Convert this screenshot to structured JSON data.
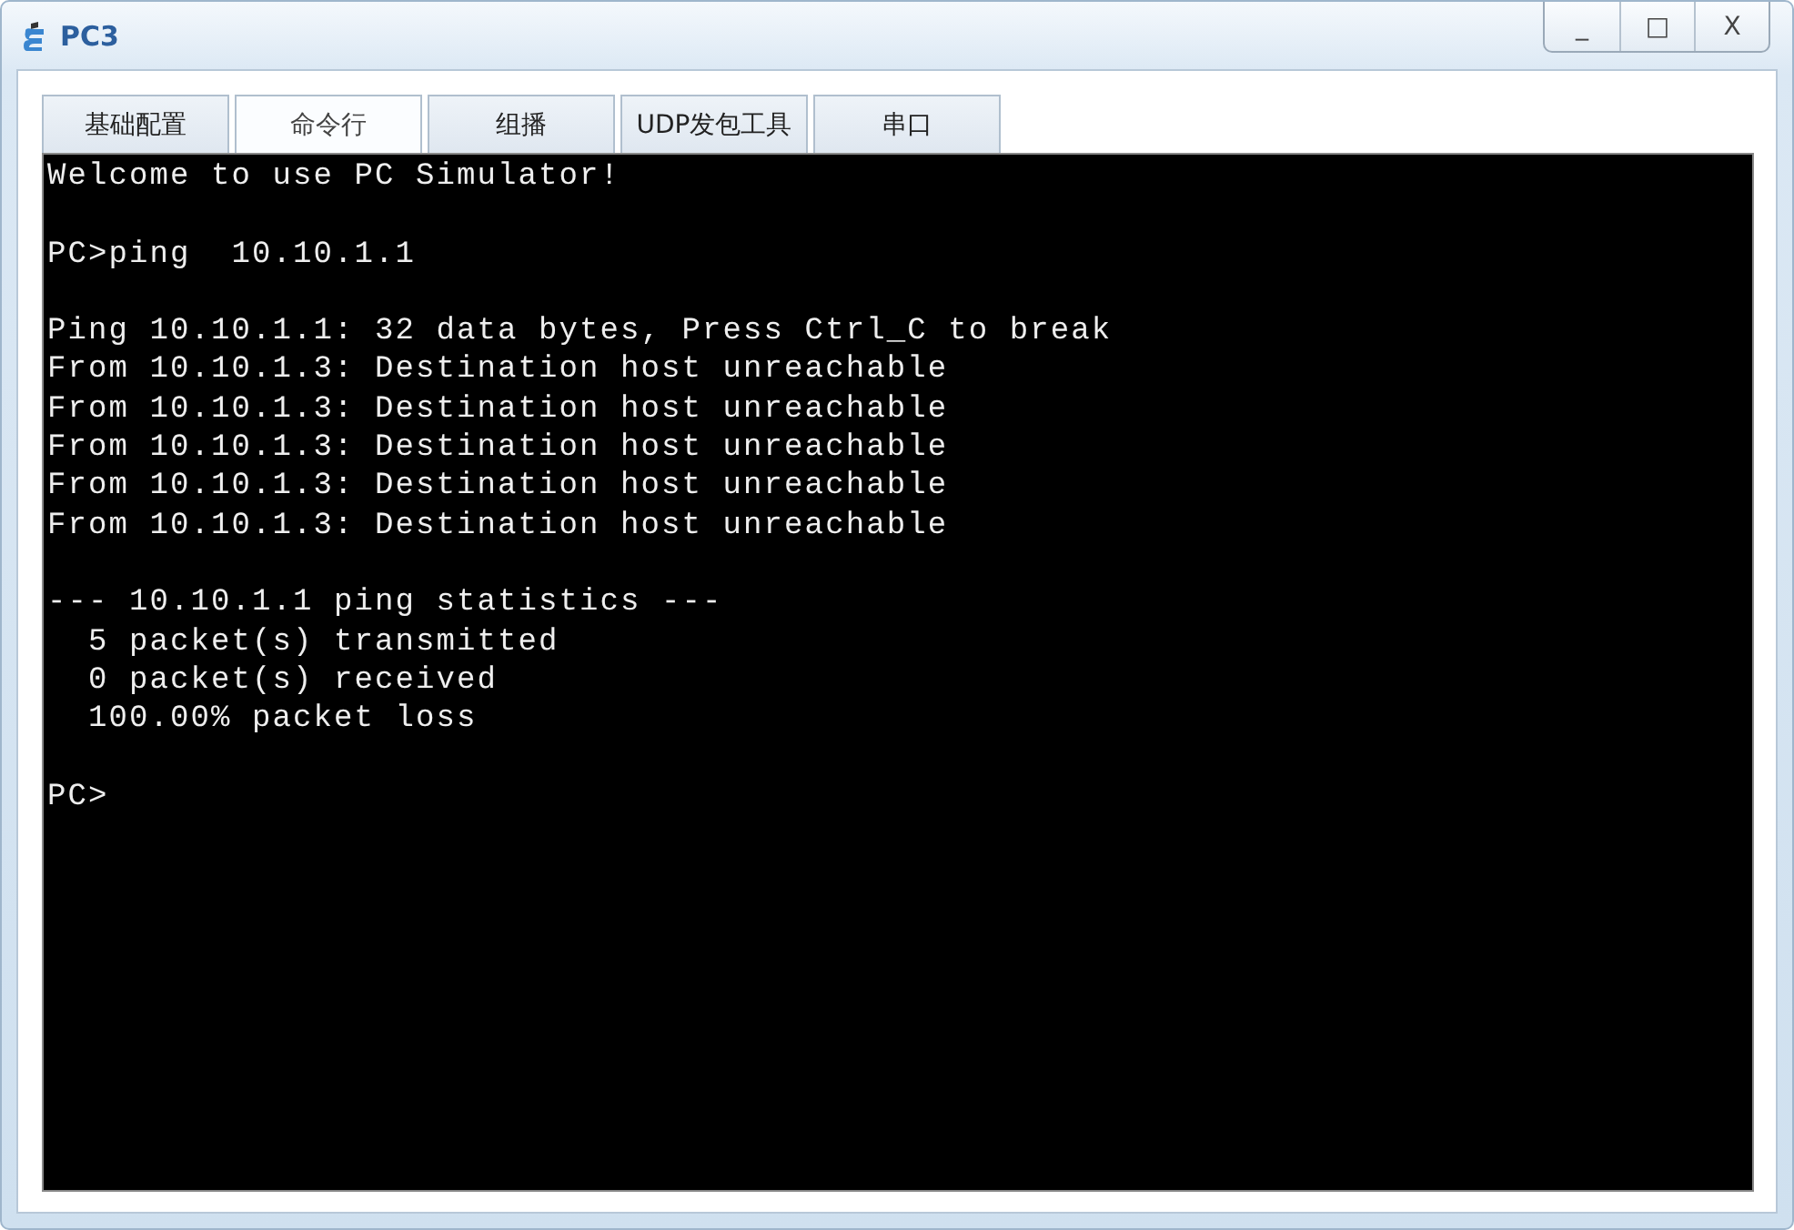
{
  "window": {
    "title": "PC3",
    "controls": [
      "_",
      "□",
      "X"
    ]
  },
  "tabs": [
    {
      "label": "基础配置",
      "selected": false
    },
    {
      "label": "命令行",
      "selected": true
    },
    {
      "label": "组播",
      "selected": false
    },
    {
      "label": "UDP发包工具",
      "selected": false
    },
    {
      "label": "串口",
      "selected": false
    }
  ],
  "terminal": {
    "blocks": [
      [
        "Welcome to use PC Simulator!"
      ],
      [
        "PC>ping  10.10.1.1"
      ],
      [
        "Ping 10.10.1.1: 32 data bytes, Press Ctrl_C to break",
        "From 10.10.1.3: Destination host unreachable",
        "From 10.10.1.3: Destination host unreachable",
        "From 10.10.1.3: Destination host unreachable",
        "From 10.10.1.3: Destination host unreachable",
        "From 10.10.1.3: Destination host unreachable"
      ],
      [
        "--- 10.10.1.1 ping statistics ---",
        "  5 packet(s) transmitted",
        "  0 packet(s) received",
        "  100.00% packet loss"
      ],
      [
        "PC>"
      ]
    ]
  }
}
